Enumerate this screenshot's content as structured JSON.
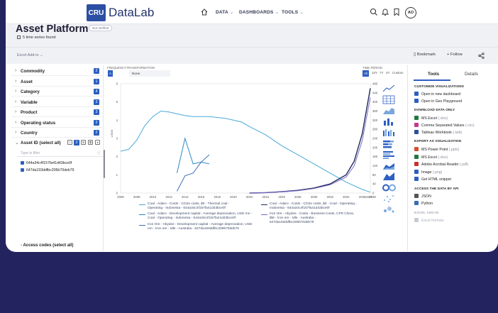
{
  "app": {
    "logo_mark": "CRU",
    "name": "DataLab",
    "nav": [
      {
        "label": "DATA"
      },
      {
        "label": "DASHBOARDS"
      },
      {
        "label": "TOOLS"
      }
    ],
    "user_initials": "AO",
    "nav_icons": [
      "home-icon",
      "search-icon",
      "bell-icon",
      "bookmark-icon"
    ]
  },
  "header": {
    "title": "Asset Platform",
    "badge": "Not Verified",
    "series_found": "5 time series found"
  },
  "toolbar": {
    "excel_addin": "Excel Add-in",
    "bookmark": "Bookmark",
    "follow": "Follow"
  },
  "filters": {
    "items": [
      {
        "label": "Commodity",
        "count": "2"
      },
      {
        "label": "Asset",
        "count": "1"
      },
      {
        "label": "Category",
        "count": "4"
      },
      {
        "label": "Variable",
        "count": "3"
      },
      {
        "label": "Product",
        "count": "3"
      },
      {
        "label": "Operating status",
        "count": "2"
      },
      {
        "label": "Country",
        "count": "2"
      }
    ],
    "asset_id_label": "Asset ID (select all)",
    "asset_id_count": "2",
    "filter_placeholder": "Type to filter",
    "asset_ids": [
      "644a34c4f157fa41d43bce0f",
      "647da193ddfbc206b70deb79"
    ],
    "access_codes": "Access codes (select all)"
  },
  "controls": {
    "frequency_label": "FREQUENCY",
    "frequency_value": "A",
    "transformation_label": "TRANSFORMATION",
    "transformation_value": "None",
    "time_period_label": "TIME PERIOD",
    "periods": [
      "All",
      "10Y",
      "7Y",
      "3Y",
      "Custom"
    ]
  },
  "chart_data": {
    "type": "line",
    "x_ticks": [
      "2006",
      "2008",
      "2010",
      "2012",
      "2014",
      "2016",
      "2018",
      "2020",
      "2022",
      "2024",
      "2026",
      "2028",
      "2030",
      "2032",
      "2034",
      "2036",
      "2038"
    ],
    "x_last_tick": "2037",
    "xlim": [
      2006,
      2037
    ],
    "left_axis": {
      "label": "USD/t",
      "ticks": [
        "0",
        "1",
        "2",
        "3",
        "4",
        "5",
        "6"
      ],
      "ylim": [
        0,
        6
      ]
    },
    "right_axis": {
      "ticks": [
        "0",
        "40",
        "80",
        "120",
        "160",
        "200",
        "240",
        "280",
        "320",
        "360",
        "400",
        "440",
        "480"
      ],
      "ylim": [
        0,
        480
      ]
    },
    "series": [
      {
        "name": "Coal - Adaro - Costs - CO2e costs, $/t - Thermal coal - Operating - Indonesia - 644a34c4f157fa41d43bce0f",
        "axis": "left",
        "color": "#4aa8d8",
        "x": [
          2006,
          2007,
          2008,
          2009,
          2010,
          2011,
          2012,
          2013,
          2014,
          2015,
          2016,
          2017,
          2018,
          2019,
          2020,
          2021,
          2022,
          2024,
          2026,
          2028,
          2030,
          2032,
          2034,
          2036,
          2037
        ],
        "y": [
          2.3,
          2.4,
          2.9,
          3.7,
          4.2,
          4.5,
          4.45,
          4.35,
          4.25,
          4.2,
          4.2,
          4.2,
          4.15,
          4.1,
          4.0,
          3.9,
          3.65,
          3.2,
          2.6,
          2.1,
          1.6,
          1.1,
          0.6,
          0.2,
          0.05
        ]
      },
      {
        "name": "Coal - Adaro - Costs - CO2e costs, $/t - Coal - Operating - Indonesia - 644a34c4f157fa41d43bce0f",
        "axis": "right",
        "color": "#1f2a5c",
        "x": [
          2022,
          2024,
          2026,
          2028,
          2030,
          2032,
          2034,
          2035,
          2036,
          2037
        ],
        "y": [
          0,
          2,
          6,
          12,
          22,
          40,
          80,
          140,
          260,
          460
        ]
      },
      {
        "name": "Coal - Adaro - Development capital - Average depreciation, USD mn - Coal - Operating - Indonesia - 644a34c4f157fa41d43bce0f",
        "axis": "left",
        "color": "#2c89c8",
        "x": [
          2013,
          2014,
          2015,
          2016,
          2017
        ],
        "y": [
          1.1,
          3.0,
          1.6,
          1.7,
          1.6
        ]
      },
      {
        "name": "Iron Ore - Abydos - Costs - Business Costs, CFR China, $M - Iron ore - Idle - Australia - 647da193ddfbc206b70deb79",
        "axis": "right",
        "color": "#7a6ac8",
        "x": [
          2022,
          2024,
          2026,
          2028,
          2030,
          2032,
          2034,
          2035,
          2036,
          2037
        ],
        "y": [
          0,
          2,
          5,
          10,
          20,
          36,
          70,
          120,
          230,
          420
        ]
      },
      {
        "name": "Iron Ore - Abydos - Development capital - Average depreciation, USD mn - Iron ore - Idle - Australia - 647da193ddfbc206b70deb79",
        "axis": "left",
        "color": "#3b6fb6",
        "x": [
          2013,
          2014,
          2015,
          2016,
          2017
        ],
        "y": [
          0.1,
          0.95,
          1.1,
          1.7,
          2.1
        ]
      }
    ]
  },
  "tools": {
    "tabs": [
      "Tools",
      "Details"
    ],
    "customize_title": "CUSTOMIZE VISUALIZATIONS",
    "customize": [
      "Open in new dashboard",
      "Open in Geo Playground"
    ],
    "download_title": "DOWNLOAD DATA ONLY",
    "download": [
      {
        "label": "MS Excel",
        "ext": "(.xlsx)",
        "color": "#1f7a3d"
      },
      {
        "label": "Comma Separated Values",
        "ext": "(.csv)",
        "color": "#c43a8e"
      },
      {
        "label": "Tableau Workbook",
        "ext": "(.twb)",
        "color": "#2a4f9a"
      }
    ],
    "export_title": "EXPORT AS VISUALIZATION",
    "export": [
      {
        "label": "MS Power Point",
        "ext": "(.pptx)",
        "color": "#d2502e"
      },
      {
        "label": "MS Excel",
        "ext": "(.xlsx)",
        "color": "#1f7a3d"
      },
      {
        "label": "Adobe Acrobat Reader",
        "ext": "(.pdf)",
        "color": "#c8322e"
      },
      {
        "label": "Image",
        "ext": "(.png)",
        "color": "#2d5fc1"
      },
      {
        "label": "Get HTML snippet",
        "ext": "",
        "color": "#2d5fc1"
      }
    ],
    "api_title": "ACCESS THE DATA BY API",
    "api": [
      {
        "label": "JSON",
        "color": "#555555"
      },
      {
        "label": "Python",
        "color": "#3a6db3"
      }
    ],
    "excel_addin_title": "EXCEL ADD-IN",
    "excel_formula": "Excel formula"
  }
}
